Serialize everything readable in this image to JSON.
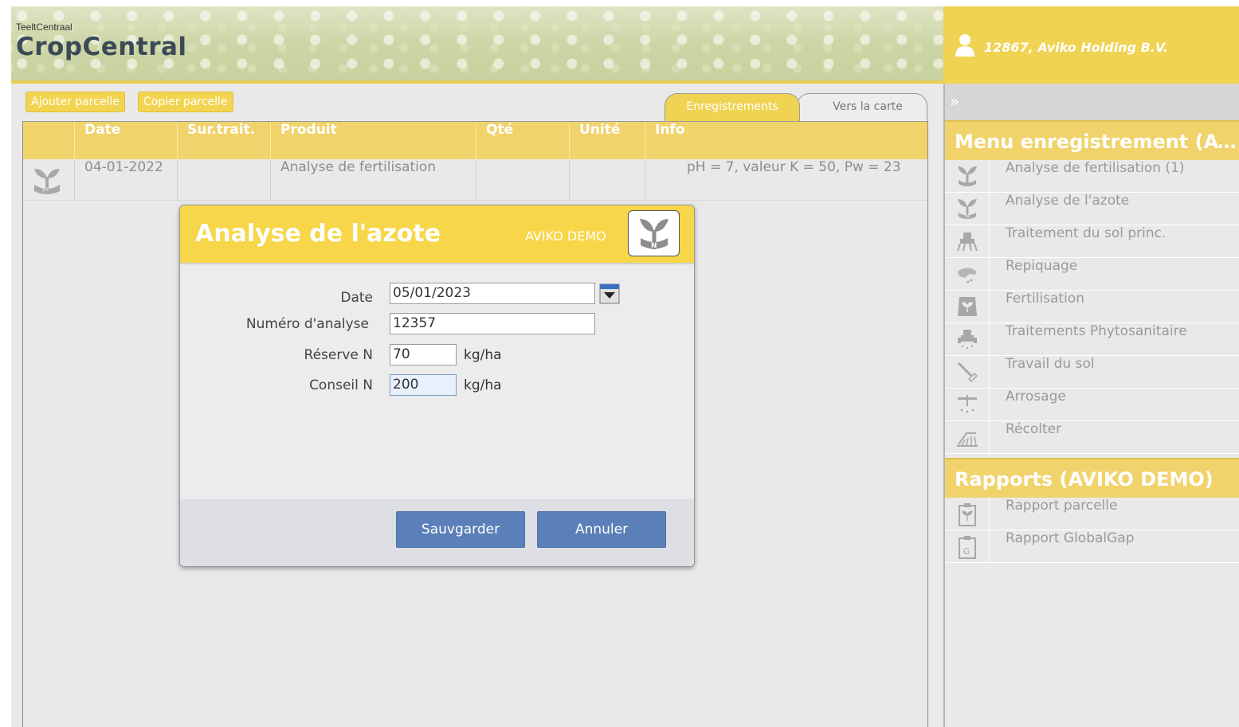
{
  "header": {
    "brand_small": "TeeltCentraal",
    "brand_big": "CropCentral",
    "user": "12867, Aviko Holding B.V."
  },
  "toolbar": {
    "add_parcel": "Ajouter parcelle",
    "copy_parcel": "Copier parcelle",
    "tab_records": "Enregistrements",
    "tab_map": "Vers la carte"
  },
  "table": {
    "columns": [
      "Date",
      "Sur.trait.",
      "Produit",
      "Qté",
      "Unité",
      "Info"
    ],
    "rows": [
      {
        "date": "04-01-2022",
        "surtrait": "",
        "produit": "Analyse de fertilisation",
        "qte": "",
        "unite": "",
        "info": "pH = 7, valeur K = 50, Pw = 23"
      }
    ]
  },
  "sidebar": {
    "collapse": "»",
    "menu_title": "Menu enregistrement (AVIKO DEMO)",
    "menu_items": [
      {
        "label": "Analyse de fertilisation (1)",
        "icon": "plant-pk-icon"
      },
      {
        "label": "Analyse de l'azote",
        "icon": "plant-n-icon"
      },
      {
        "label": "Traitement du sol princ.",
        "icon": "soil-treatment-icon"
      },
      {
        "label": "Repiquage",
        "icon": "planting-hand-icon"
      },
      {
        "label": "Fertilisation",
        "icon": "fertilizer-bag-icon"
      },
      {
        "label": "Traitements Phytosanitaire",
        "icon": "sprayer-icon"
      },
      {
        "label": "Travail du sol",
        "icon": "hoe-icon"
      },
      {
        "label": "Arrosage",
        "icon": "sprinkler-icon"
      },
      {
        "label": "Récolter",
        "icon": "harvester-icon"
      }
    ],
    "reports_title": "Rapports (AVIKO DEMO)",
    "report_items": [
      {
        "label": "Rapport parcelle",
        "icon": "clipboard-plant-icon"
      },
      {
        "label": "Rapport GlobalGap",
        "icon": "clipboard-g-icon"
      }
    ]
  },
  "modal": {
    "title": "Analyse de l'azote",
    "subtitle": "AVIKO DEMO",
    "fields": {
      "date_label": "Date",
      "date_value": "05/01/2023",
      "analysis_label": "Numéro d'analyse",
      "analysis_value": "12357",
      "reserve_label": "Réserve N",
      "reserve_value": "70",
      "reserve_unit": "kg/ha",
      "advice_label": "Conseil N",
      "advice_value": "200",
      "advice_unit": "kg/ha"
    },
    "save": "Sauvgarder",
    "cancel": "Annuler"
  },
  "colors": {
    "accent_yellow": "#f0d352",
    "button_blue": "#5b7fb8",
    "brand_text": "#3a4a57"
  }
}
